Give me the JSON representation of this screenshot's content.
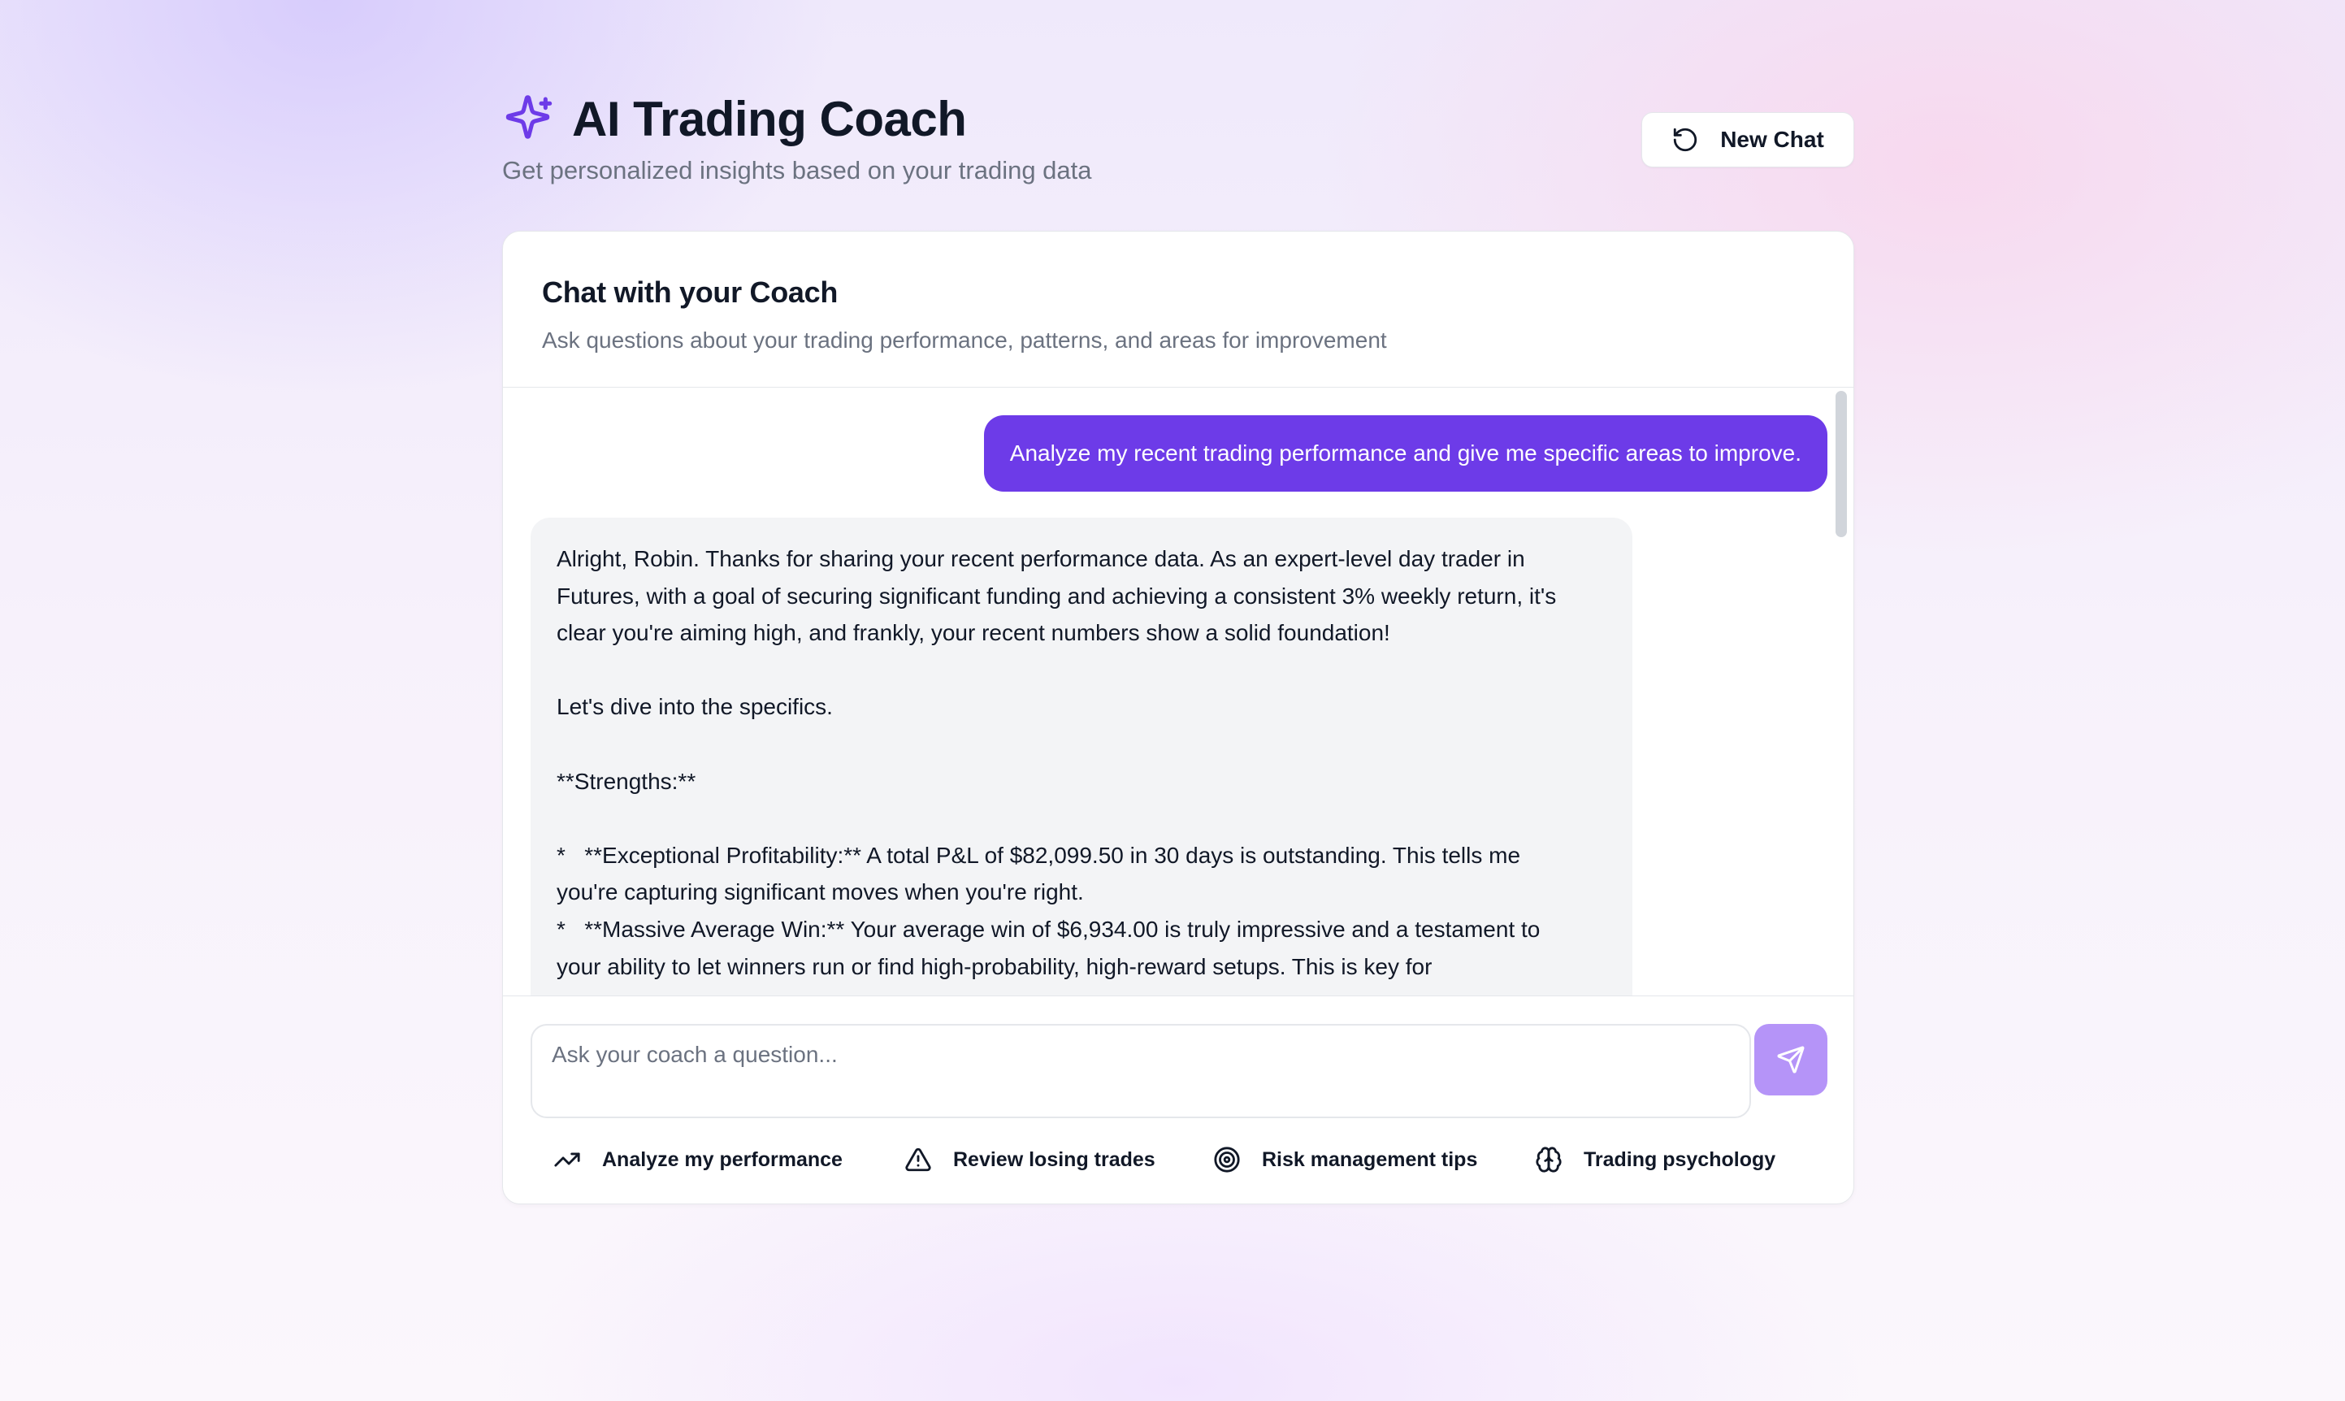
{
  "header": {
    "title": "AI Trading Coach",
    "subtitle": "Get personalized insights based on your trading data",
    "new_chat_label": "New Chat",
    "icons": {
      "title": "sparkles-icon",
      "new_chat": "rotate-ccw-icon"
    }
  },
  "card": {
    "title": "Chat with your Coach",
    "subtitle": "Ask questions about your trading performance, patterns, and areas for improvement"
  },
  "messages": {
    "user": "Analyze my recent trading performance and give me specific areas to improve.",
    "assistant_lines": [
      "Alright, Robin. Thanks for sharing your recent performance data. As an expert-level day trader in",
      "Futures, with a goal of securing significant funding and achieving a consistent 3% weekly return, it's",
      "clear you're aiming high, and frankly, your recent numbers show a solid foundation!",
      "",
      "Let's dive into the specifics.",
      "",
      "**Strengths:**",
      "",
      "*   **Exceptional Profitability:** A total P&L of $82,099.50 in 30 days is outstanding. This tells me",
      "you're capturing significant moves when you're right.",
      "*   **Massive Average Win:** Your average win of $6,934.00 is truly impressive and a testament to",
      "your ability to let winners run or find high-probability, high-reward setups. This is key for"
    ]
  },
  "composer": {
    "placeholder": "Ask your coach a question...",
    "value": ""
  },
  "quick_actions": [
    {
      "label": "Analyze my performance",
      "icon": "trending-up-icon"
    },
    {
      "label": "Review losing trades",
      "icon": "alert-triangle-icon"
    },
    {
      "label": "Risk management tips",
      "icon": "target-icon"
    },
    {
      "label": "Trading psychology",
      "icon": "brain-icon"
    }
  ],
  "colors": {
    "accent": "#6d3be8",
    "send_button": "#b594f8",
    "bubble_bg": "#f3f4f6",
    "text_muted": "#6b7280"
  }
}
